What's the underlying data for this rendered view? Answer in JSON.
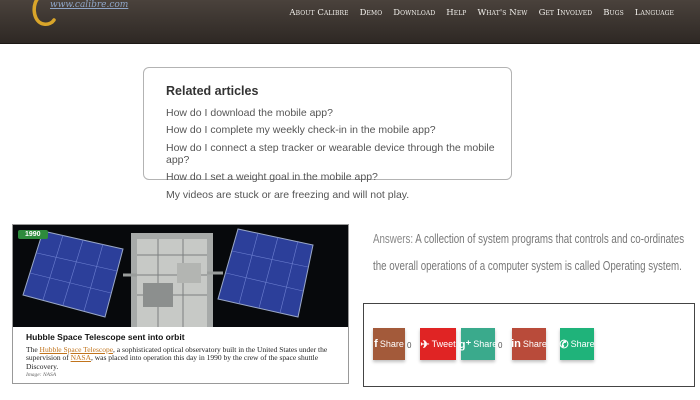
{
  "header": {
    "logo_text": "www.calibre.com",
    "nav": [
      "About Calibre",
      "Demo",
      "Download",
      "Help",
      "What's New",
      "Get Involved",
      "Bugs",
      "Language"
    ]
  },
  "related": {
    "title": "Related articles",
    "items": [
      "How do I download the mobile app?",
      "How do I complete my weekly check-in in the mobile app?",
      "How do I connect a step tracker or wearable device through the mobile app?",
      "How do I set a weight goal in the mobile app?",
      "My videos are stuck or are freezing and will not play."
    ]
  },
  "hubble": {
    "year": "1990",
    "headline": "Hubble Space Telescope sent into orbit",
    "desc_before": "The ",
    "desc_link1": "Hubble Space Telescope",
    "desc_mid": ", a sophisticated optical observatory built in the United States under the supervision of ",
    "desc_link2": "NASA",
    "desc_after": ", was placed into operation this day in 1990 by the crew of the space shuttle Discovery.",
    "credit": "Image: NASA"
  },
  "answer": {
    "prefix": "Answers:",
    "text": " A collection of system programs that controls and co-ordinates the overall operations of a computer system is called Operating system."
  },
  "share": {
    "facebook": {
      "label": "Share",
      "count": "0",
      "color": "#a35a3a"
    },
    "twitter": {
      "label": "Tweet",
      "color": "#e02424"
    },
    "googleplus": {
      "label": "Share",
      "count": "0",
      "color": "#3aaa8c"
    },
    "linkedin": {
      "label": "Share",
      "color": "#b94b3a"
    },
    "whatsapp": {
      "label": "Share",
      "color": "#1fb37a"
    }
  }
}
